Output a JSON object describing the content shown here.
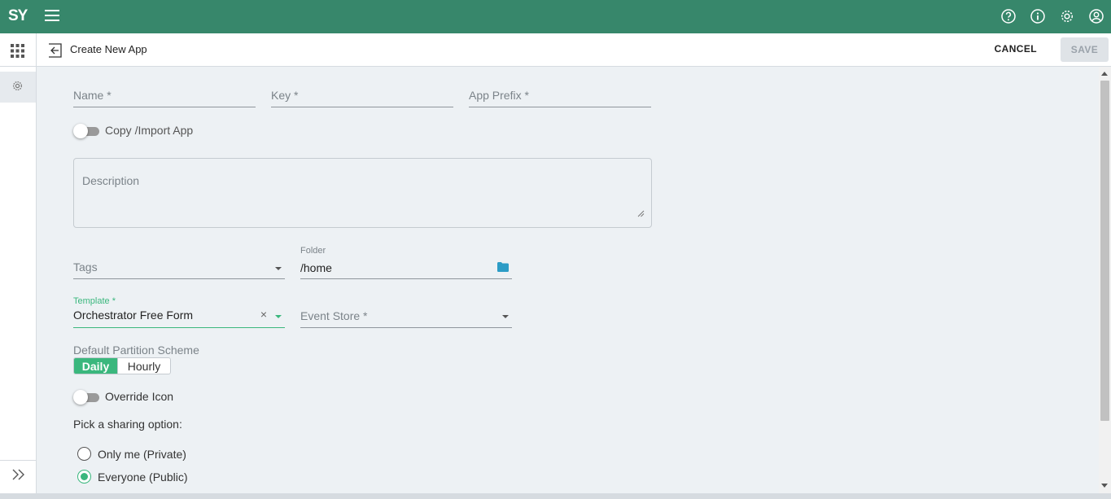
{
  "topbar": {
    "logo": "SY",
    "icons": [
      "help-icon",
      "info-icon",
      "settings-icon",
      "account-icon"
    ]
  },
  "header": {
    "title": "Create New App",
    "cancel_label": "CANCEL",
    "save_label": "SAVE"
  },
  "form": {
    "name_placeholder": "Name *",
    "key_placeholder": "Key *",
    "app_prefix_placeholder": "App Prefix *",
    "copy_import_label": "Copy /Import App",
    "description_placeholder": "Description",
    "tags_placeholder": "Tags",
    "folder_label": "Folder",
    "folder_value": "/home",
    "template_label": "Template *",
    "template_value": "Orchestrator Free Form",
    "event_store_placeholder": "Event Store *",
    "partition_label": "Default Partition Scheme",
    "partition_options": [
      "Daily",
      "Hourly"
    ],
    "partition_selected": "Daily",
    "override_icon_label": "Override Icon",
    "sharing_label": "Pick a sharing option:",
    "sharing_options": [
      "Only me (Private)",
      "Everyone (Public)"
    ],
    "sharing_selected": "Everyone (Public)"
  },
  "colors": {
    "brand": "#37876b",
    "accent": "#3ab77d",
    "folder_icon": "#2c9cc6"
  }
}
